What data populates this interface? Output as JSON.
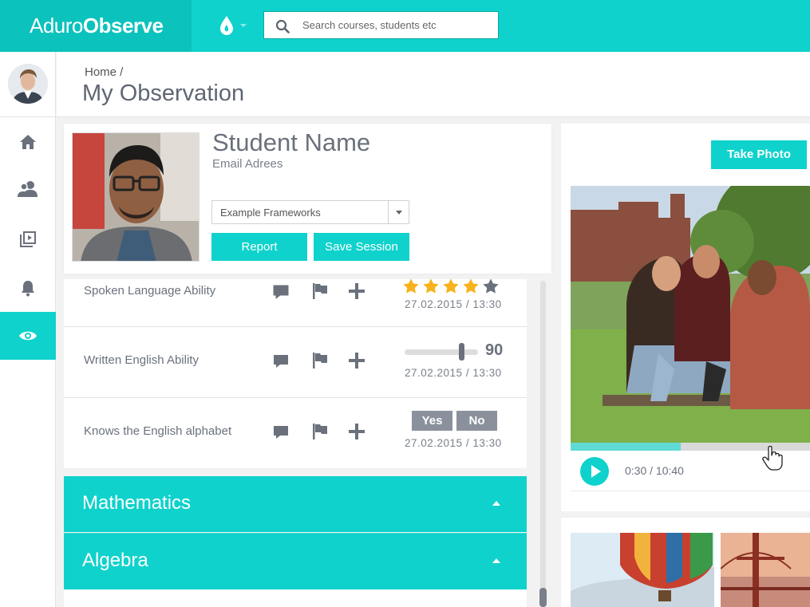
{
  "brand": {
    "prefix": "Aduro",
    "suffix": "Observe"
  },
  "search": {
    "placeholder": "Search courses, students etc"
  },
  "sidebar": {
    "items": [
      {
        "name": "home",
        "icon": "home-icon"
      },
      {
        "name": "students",
        "icon": "users-icon"
      },
      {
        "name": "media",
        "icon": "video-library-icon"
      },
      {
        "name": "notifications",
        "icon": "bell-icon"
      },
      {
        "name": "observe",
        "icon": "eye-icon",
        "active": true
      }
    ]
  },
  "header": {
    "breadcrumb": "Home /",
    "title": "My Observation"
  },
  "student": {
    "name": "Student Name",
    "email": "Email Adrees",
    "framework": "Example Frameworks",
    "report_label": "Report",
    "save_label": "Save Session"
  },
  "criteria": [
    {
      "label": "Spoken Language Ability",
      "type": "stars",
      "rating": 4,
      "max": 5,
      "date": "27.02.2015 / 13:30"
    },
    {
      "label": "Written English Ability",
      "type": "slider",
      "value": "90",
      "date": "27.02.2015 / 13:30"
    },
    {
      "label": "Knows the English alphabet",
      "type": "yesno",
      "yes_label": "Yes",
      "no_label": "No",
      "date": "27.02.2015 / 13:30"
    }
  ],
  "subjects": [
    {
      "label": "Mathematics"
    },
    {
      "label": "Algebra"
    }
  ],
  "media": {
    "take_photo_label": "Take Photo",
    "time": "0:30 / 10:40",
    "progress": 0.46
  },
  "colors": {
    "accent": "#0fd2cc",
    "brand_dark": "#0bc2bc",
    "star": "#f7b21c",
    "star_empty": "#6a717c"
  }
}
